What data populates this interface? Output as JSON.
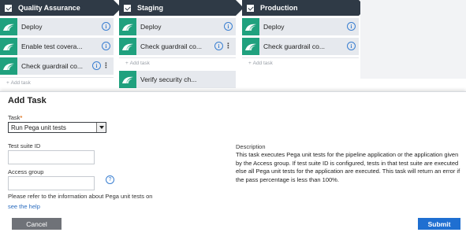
{
  "pipeline": {
    "stages": [
      {
        "title": "Quality Assurance",
        "tasks": [
          {
            "label": "Deploy"
          },
          {
            "label": "Enable test covera..."
          },
          {
            "label": "Check guardrail co..."
          }
        ],
        "add_task": "Add task"
      },
      {
        "title": "Staging",
        "tasks": [
          {
            "label": "Deploy"
          },
          {
            "label": "Check guardrail co..."
          },
          {
            "label": "Verify security ch..."
          }
        ],
        "add_task": "Add task"
      },
      {
        "title": "Production",
        "tasks": [
          {
            "label": "Deploy"
          },
          {
            "label": "Check guardrail co..."
          }
        ],
        "add_task": "Add task"
      }
    ]
  },
  "modal": {
    "title": "Add Task",
    "task_label": "Task",
    "required_marker": "*",
    "task_selected": "Run Pega unit tests",
    "test_suite_label": "Test suite ID",
    "test_suite_value": "",
    "access_group_label": "Access group",
    "access_group_value": "",
    "help_icon": "?",
    "note": "Please refer to the information about Pega unit tests on",
    "link": "see the help",
    "description_label": "Description",
    "description_text": "This task executes Pega unit tests for the pipeline application or the application given by the Access group. If test suite ID is configured, tests in that test suite are executed else all Pega unit tests for the application are executed. This task will return an error if the pass percentage is less than 100%.",
    "cancel_label": "Cancel",
    "submit_label": "Submit"
  },
  "colors": {
    "stage_header": "#2f3a46",
    "task_icon": "#20a17e",
    "task_bg": "#e6e9ee",
    "submit": "#1f6fd1",
    "cancel": "#6f7278"
  }
}
